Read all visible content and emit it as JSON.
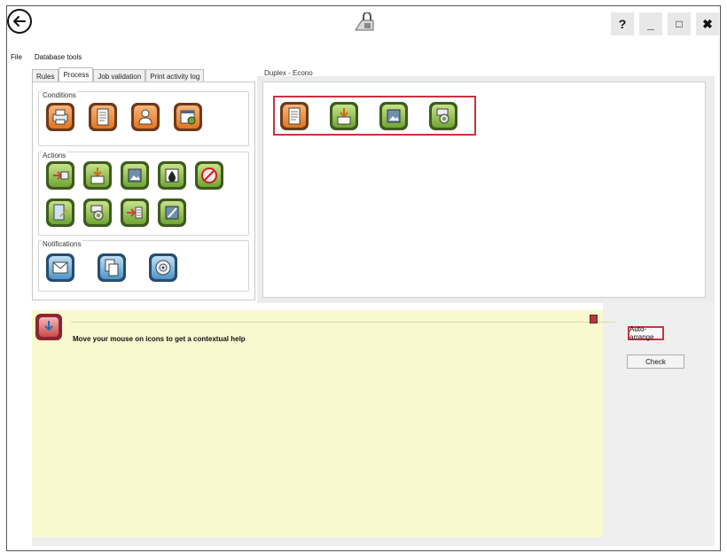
{
  "window": {
    "help_label": "?",
    "minimize_label": "_",
    "maximize_label": "□",
    "close_label": "✖"
  },
  "menu": {
    "items": [
      "File",
      "Database tools"
    ]
  },
  "tabs": [
    "Rules",
    "Process",
    "Job validation",
    "Print activity log"
  ],
  "active_tab": "Process",
  "groups": {
    "conditions": {
      "label": "Conditions",
      "icons": [
        "printer-icon",
        "document-icon",
        "user-icon",
        "calendar-clock-icon"
      ]
    },
    "actions": {
      "label": "Actions",
      "icons_row1": [
        "forward-printer-icon",
        "pdf-download-icon",
        "image-icon",
        "ink-drop-icon",
        "no-print-icon"
      ],
      "icons_row2": [
        "document-edit-icon",
        "printer-settings-icon",
        "stack-arrow-icon",
        "pen-icon"
      ]
    },
    "notifications": {
      "label": "Notifications",
      "icons": [
        "email-icon",
        "copy-document-icon",
        "sound-icon"
      ]
    }
  },
  "workspace": {
    "title": "Duplex - Econo",
    "icons": [
      "document-icon",
      "pdf-download-icon",
      "image-icon",
      "printer-settings-icon"
    ]
  },
  "help": {
    "text": "Move your mouse on icons to get a contextual help"
  },
  "buttons": {
    "auto_arrange": "Auto-arrange",
    "check": "Check"
  },
  "colors": {
    "accent_red": "#c9333d",
    "help_bg": "#f9f8cf",
    "green": "#6ea533",
    "orange": "#e4751f",
    "blue": "#4e95c9"
  }
}
